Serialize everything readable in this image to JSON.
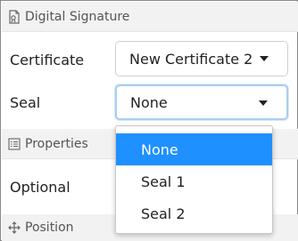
{
  "sections": {
    "digital_signature": {
      "title": "Digital Signature",
      "icon": "document-seal-icon"
    },
    "properties": {
      "title": "Properties",
      "icon": "list-icon"
    },
    "position": {
      "title": "Position",
      "icon": "move-arrows-icon"
    }
  },
  "fields": {
    "certificate": {
      "label": "Certificate",
      "value": "New Certificate 2"
    },
    "seal": {
      "label": "Seal",
      "value": "None"
    },
    "optional": {
      "label": "Optional"
    }
  },
  "seal_dropdown": {
    "options": [
      "None",
      "Seal 1",
      "Seal 2"
    ],
    "selected_index": 0,
    "highlight_color": "#1e90ff"
  }
}
